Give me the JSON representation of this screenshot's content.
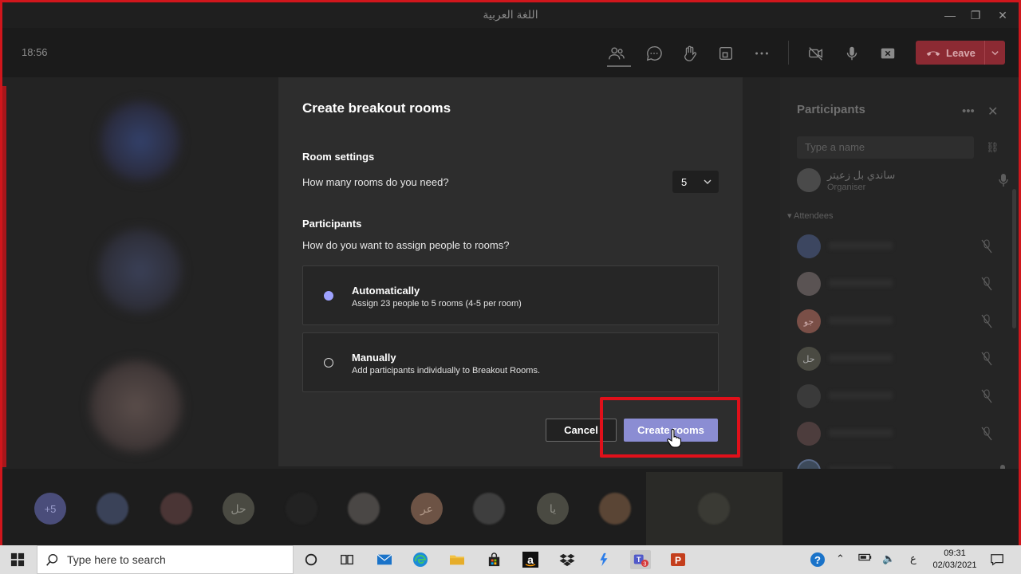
{
  "window": {
    "title": "اللغة العربية",
    "minimize": "—",
    "restore": "❐",
    "close": "✕"
  },
  "toolbar": {
    "timer": "18:56",
    "leave_label": "Leave"
  },
  "dialog": {
    "title": "Create breakout rooms",
    "room_settings_heading": "Room settings",
    "rooms_question": "How many rooms do you need?",
    "rooms_count": "5",
    "participants_heading": "Participants",
    "assign_question": "How do you want to assign people to rooms?",
    "options": [
      {
        "title": "Automatically",
        "description": "Assign 23 people to 5 rooms (4-5 per room)",
        "selected": true
      },
      {
        "title": "Manually",
        "description": "Add participants individually to Breakout Rooms.",
        "selected": false
      }
    ],
    "cancel_label": "Cancel",
    "create_label": "Create rooms"
  },
  "participants_panel": {
    "title": "Participants",
    "search_placeholder": "Type a name",
    "organiser_name": "ساندي بل زعيتر",
    "organiser_role": "Organiser",
    "attendees_label": "Attendees",
    "rows": [
      {
        "initials": ""
      },
      {
        "initials": ""
      },
      {
        "initials": "جو"
      },
      {
        "initials": "حل"
      },
      {
        "initials": ""
      },
      {
        "initials": ""
      },
      {
        "initials": ""
      },
      {
        "initials": ""
      }
    ]
  },
  "gallery": {
    "overflow_count": "+5",
    "initials": [
      "حل",
      "عر",
      "يا"
    ]
  },
  "taskbar": {
    "search_placeholder": "Type here to search",
    "teams_badge": "3",
    "lang": "ع",
    "time": "09:31",
    "date": "02/03/2021"
  },
  "colors": {
    "accent": "#8b8dd3",
    "leave": "#8c2a33",
    "highlight": "#e0101a",
    "radio_on": "#9ea2ff"
  }
}
